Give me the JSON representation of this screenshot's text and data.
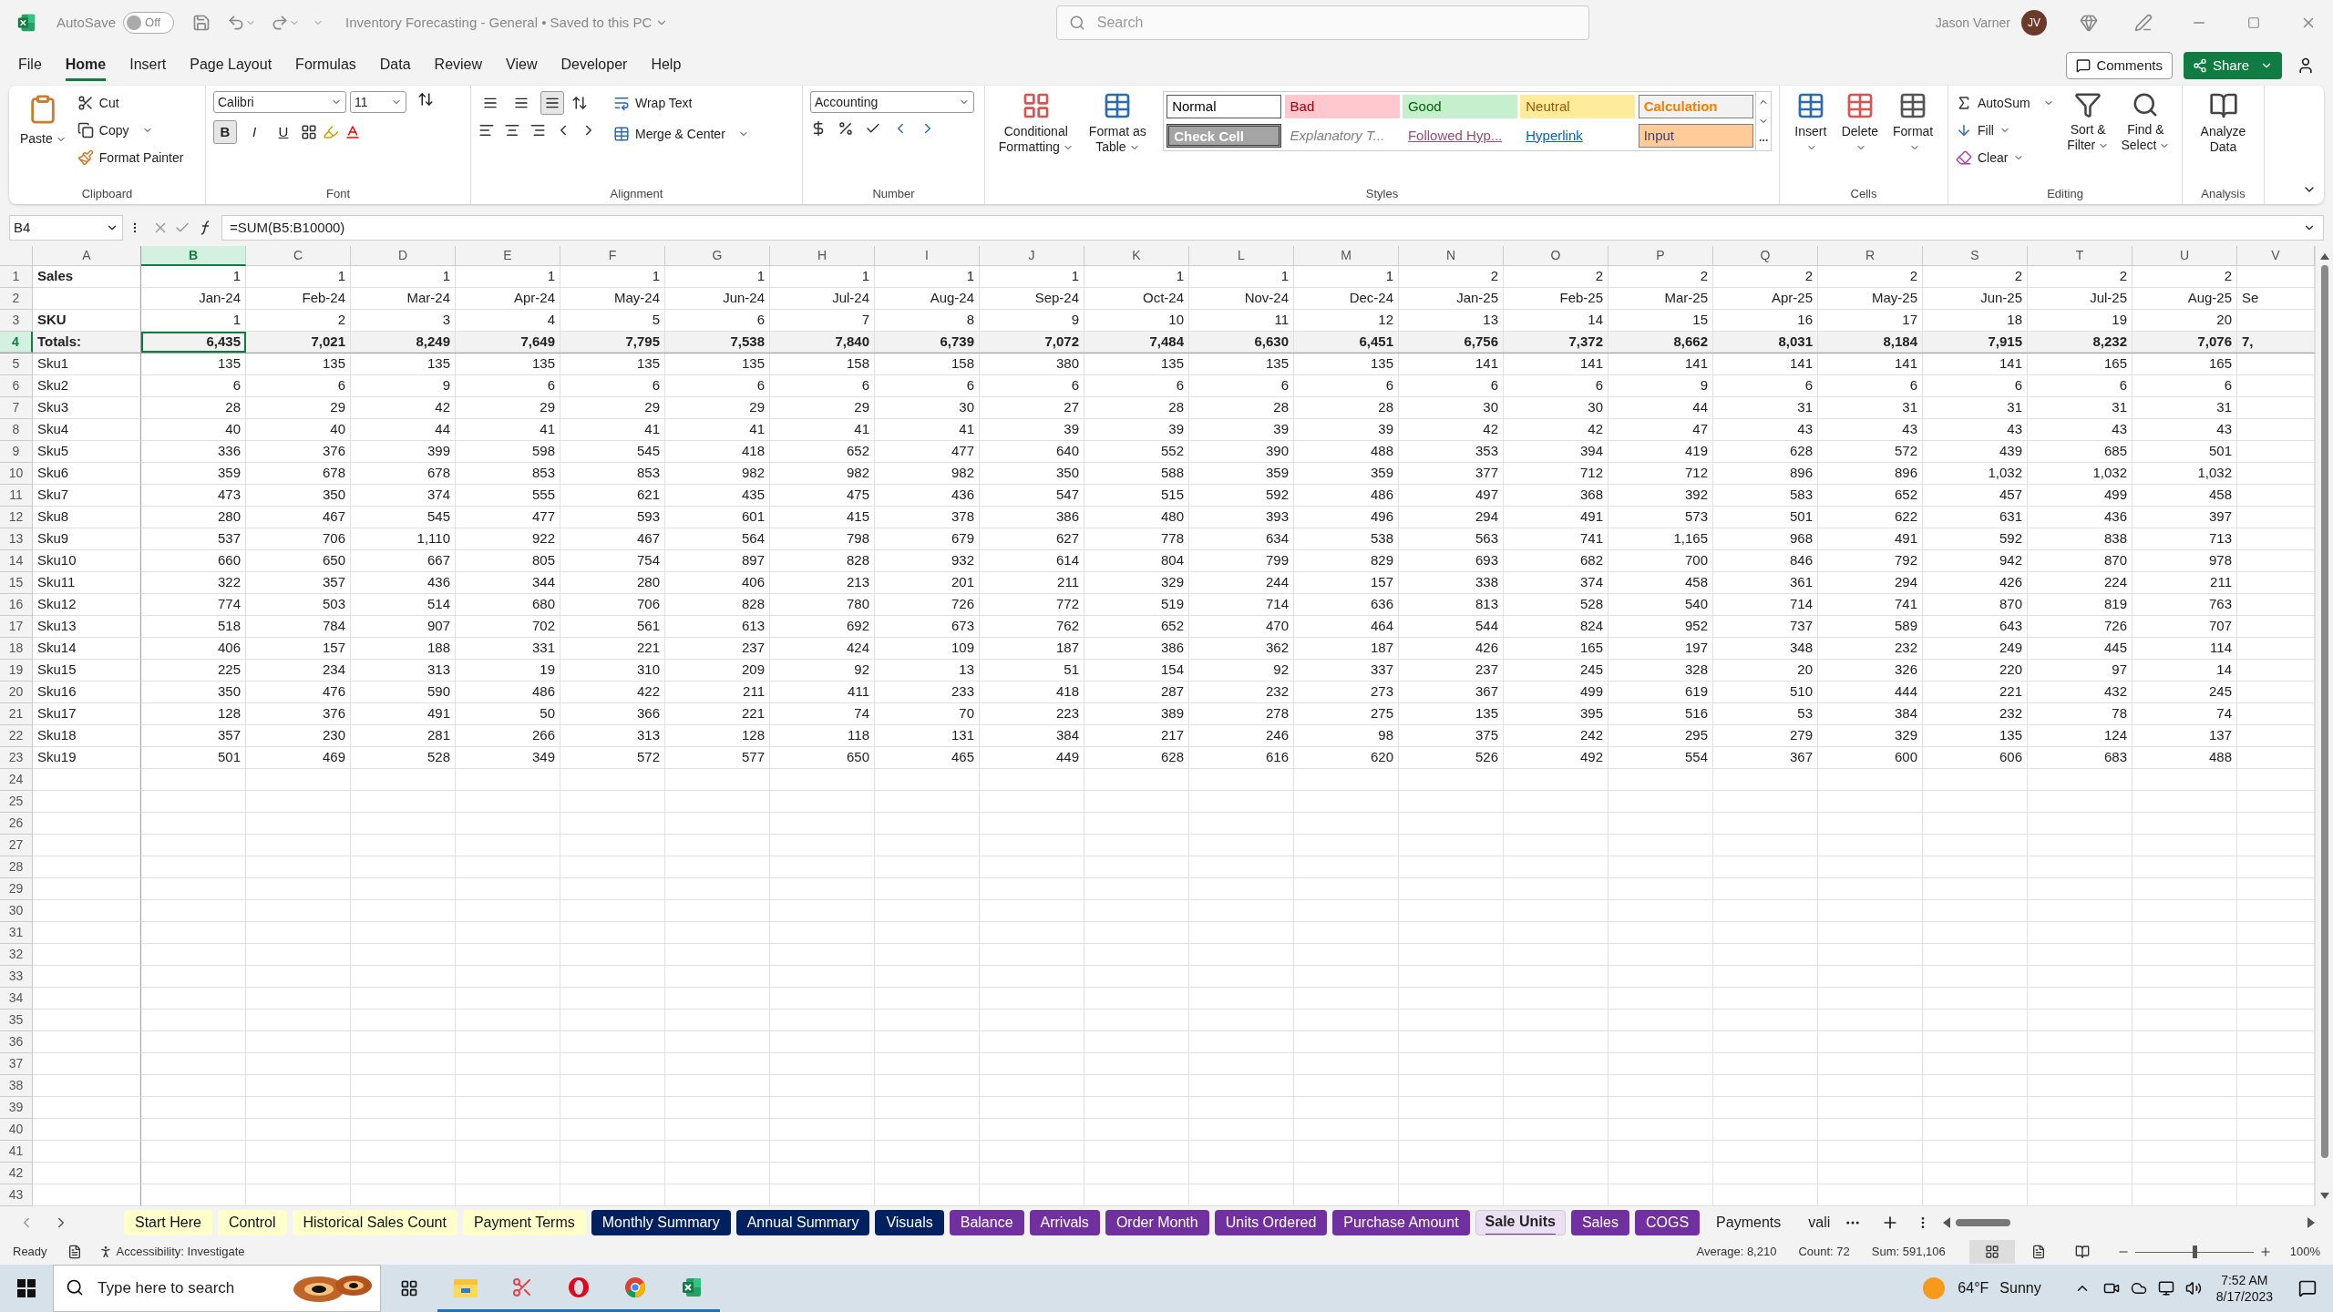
{
  "title_bar": {
    "autosave_label": "AutoSave",
    "autosave_on": false,
    "autosave_state": "Off",
    "document_title": "Inventory Forecasting - General • Saved to this PC",
    "search_placeholder": "Search",
    "user_name": "Jason Varner",
    "user_initials": "JV"
  },
  "menu_tabs": [
    {
      "label": "File",
      "selected": false
    },
    {
      "label": "Home",
      "selected": true
    },
    {
      "label": "Insert",
      "selected": false
    },
    {
      "label": "Page Layout",
      "selected": false
    },
    {
      "label": "Formulas",
      "selected": false
    },
    {
      "label": "Data",
      "selected": false
    },
    {
      "label": "Review",
      "selected": false
    },
    {
      "label": "View",
      "selected": false
    },
    {
      "label": "Developer",
      "selected": false
    },
    {
      "label": "Help",
      "selected": false
    }
  ],
  "header_buttons": {
    "comments": "Comments",
    "share": "Share"
  },
  "ribbon": {
    "clipboard": {
      "label": "Clipboard",
      "paste": "Paste",
      "cut": "Cut",
      "copy": "Copy",
      "format_painter": "Format Painter"
    },
    "font": {
      "label": "Font",
      "name": "Calibri",
      "size": "11",
      "styles": [
        {
          "label": "B",
          "selected": true
        },
        {
          "label": "I",
          "selected": false
        },
        {
          "label": "U",
          "selected": false
        }
      ]
    },
    "alignment": {
      "label": "Alignment",
      "vertical": [
        {
          "selected": false
        },
        {
          "selected": false
        },
        {
          "selected": true
        }
      ],
      "wrap_text": "Wrap Text",
      "merge_center": "Merge & Center"
    },
    "number": {
      "label": "Number",
      "format": "Accounting"
    },
    "styles": {
      "label": "Styles",
      "conditional_formatting": "Conditional Formatting",
      "format_as_table": "Format as Table",
      "items": [
        {
          "label": "Normal",
          "kind": "normal"
        },
        {
          "label": "Bad",
          "kind": "bad"
        },
        {
          "label": "Good",
          "kind": "good"
        },
        {
          "label": "Neutral",
          "kind": "neutral"
        },
        {
          "label": "Calculation",
          "kind": "calculation"
        },
        {
          "label": "Check Cell",
          "kind": "check"
        },
        {
          "label": "Explanatory T...",
          "kind": "explanatory"
        },
        {
          "label": "Followed Hyp...",
          "kind": "followed"
        },
        {
          "label": "Hyperlink",
          "kind": "hyperlink"
        },
        {
          "label": "Input",
          "kind": "input"
        }
      ]
    },
    "cells": {
      "label": "Cells",
      "insert": "Insert",
      "delete": "Delete",
      "format": "Format"
    },
    "editing": {
      "label": "Editing",
      "autosum": "AutoSum",
      "fill": "Fill",
      "clear": "Clear",
      "sort_filter": "Sort & Filter",
      "find_select": "Find & Select"
    },
    "analysis": {
      "label": "Analysis",
      "analyze_data": "Analyze Data"
    }
  },
  "formula_bar": {
    "name_box": "B4",
    "formula": "=SUM(B5:B10000)"
  },
  "columns": [
    {
      "letter": "A",
      "selected": false
    },
    {
      "letter": "B",
      "selected": true
    },
    {
      "letter": "C",
      "selected": false
    },
    {
      "letter": "D",
      "selected": false
    },
    {
      "letter": "E",
      "selected": false
    },
    {
      "letter": "F",
      "selected": false
    },
    {
      "letter": "G",
      "selected": false
    },
    {
      "letter": "H",
      "selected": false
    },
    {
      "letter": "I",
      "selected": false
    },
    {
      "letter": "J",
      "selected": false
    },
    {
      "letter": "K",
      "selected": false
    },
    {
      "letter": "L",
      "selected": false
    },
    {
      "letter": "M",
      "selected": false
    },
    {
      "letter": "N",
      "selected": false
    },
    {
      "letter": "O",
      "selected": false
    },
    {
      "letter": "P",
      "selected": false
    },
    {
      "letter": "Q",
      "selected": false
    },
    {
      "letter": "R",
      "selected": false
    },
    {
      "letter": "S",
      "selected": false
    },
    {
      "letter": "T",
      "selected": false
    },
    {
      "letter": "U",
      "selected": false
    },
    {
      "letter": "V",
      "selected": false
    }
  ],
  "rows": [
    {
      "number": "1",
      "kind": "header",
      "selected": false,
      "label": "Sales",
      "values": [
        "1",
        "1",
        "1",
        "1",
        "1",
        "1",
        "1",
        "1",
        "1",
        "1",
        "1",
        "1",
        "2",
        "2",
        "2",
        "2",
        "2",
        "2",
        "2",
        "2"
      ]
    },
    {
      "number": "2",
      "kind": "header",
      "selected": false,
      "values": [
        "Jan-24",
        "Feb-24",
        "Mar-24",
        "Apr-24",
        "May-24",
        "Jun-24",
        "Jul-24",
        "Aug-24",
        "Sep-24",
        "Oct-24",
        "Nov-24",
        "Dec-24",
        "Jan-25",
        "Feb-25",
        "Mar-25",
        "Apr-25",
        "May-25",
        "Jun-25",
        "Jul-25",
        "Aug-25",
        "Se"
      ]
    },
    {
      "number": "3",
      "kind": "header",
      "selected": false,
      "label": "SKU",
      "values": [
        "1",
        "2",
        "3",
        "4",
        "5",
        "6",
        "7",
        "8",
        "9",
        "10",
        "11",
        "12",
        "13",
        "14",
        "15",
        "16",
        "17",
        "18",
        "19",
        "20"
      ]
    },
    {
      "number": "4",
      "kind": "totals",
      "selected": true,
      "label": "Totals:",
      "values": [
        "6,435",
        "7,021",
        "8,249",
        "7,649",
        "7,795",
        "7,538",
        "7,840",
        "6,739",
        "7,072",
        "7,484",
        "6,630",
        "6,451",
        "6,756",
        "7,372",
        "8,662",
        "8,031",
        "8,184",
        "7,915",
        "8,232",
        "7,076",
        "7,"
      ]
    },
    {
      "number": "5",
      "kind": "data",
      "selected": false,
      "label": "Sku1",
      "values": [
        "135",
        "135",
        "135",
        "135",
        "135",
        "135",
        "158",
        "158",
        "380",
        "135",
        "135",
        "135",
        "141",
        "141",
        "141",
        "141",
        "141",
        "141",
        "165",
        "165"
      ]
    },
    {
      "number": "6",
      "kind": "data",
      "selected": false,
      "label": "Sku2",
      "values": [
        "6",
        "6",
        "9",
        "6",
        "6",
        "6",
        "6",
        "6",
        "6",
        "6",
        "6",
        "6",
        "6",
        "6",
        "9",
        "6",
        "6",
        "6",
        "6",
        "6"
      ]
    },
    {
      "number": "7",
      "kind": "data",
      "selected": false,
      "label": "Sku3",
      "values": [
        "28",
        "29",
        "42",
        "29",
        "29",
        "29",
        "29",
        "30",
        "27",
        "28",
        "28",
        "28",
        "30",
        "30",
        "44",
        "31",
        "31",
        "31",
        "31",
        "31"
      ]
    },
    {
      "number": "8",
      "kind": "data",
      "selected": false,
      "label": "Sku4",
      "values": [
        "40",
        "40",
        "44",
        "41",
        "41",
        "41",
        "41",
        "41",
        "39",
        "39",
        "39",
        "39",
        "42",
        "42",
        "47",
        "43",
        "43",
        "43",
        "43",
        "43"
      ]
    },
    {
      "number": "9",
      "kind": "data",
      "selected": false,
      "label": "Sku5",
      "values": [
        "336",
        "376",
        "399",
        "598",
        "545",
        "418",
        "652",
        "477",
        "640",
        "552",
        "390",
        "488",
        "353",
        "394",
        "419",
        "628",
        "572",
        "439",
        "685",
        "501"
      ]
    },
    {
      "number": "10",
      "kind": "data",
      "selected": false,
      "label": "Sku6",
      "values": [
        "359",
        "678",
        "678",
        "853",
        "853",
        "982",
        "982",
        "982",
        "350",
        "588",
        "359",
        "359",
        "377",
        "712",
        "712",
        "896",
        "896",
        "1,032",
        "1,032",
        "1,032"
      ]
    },
    {
      "number": "11",
      "kind": "data",
      "selected": false,
      "label": "Sku7",
      "values": [
        "473",
        "350",
        "374",
        "555",
        "621",
        "435",
        "475",
        "436",
        "547",
        "515",
        "592",
        "486",
        "497",
        "368",
        "392",
        "583",
        "652",
        "457",
        "499",
        "458"
      ]
    },
    {
      "number": "12",
      "kind": "data",
      "selected": false,
      "label": "Sku8",
      "values": [
        "280",
        "467",
        "545",
        "477",
        "593",
        "601",
        "415",
        "378",
        "386",
        "480",
        "393",
        "496",
        "294",
        "491",
        "573",
        "501",
        "622",
        "631",
        "436",
        "397"
      ]
    },
    {
      "number": "13",
      "kind": "data",
      "selected": false,
      "label": "Sku9",
      "values": [
        "537",
        "706",
        "1,110",
        "922",
        "467",
        "564",
        "798",
        "679",
        "627",
        "778",
        "634",
        "538",
        "563",
        "741",
        "1,165",
        "968",
        "491",
        "592",
        "838",
        "713"
      ]
    },
    {
      "number": "14",
      "kind": "data",
      "selected": false,
      "label": "Sku10",
      "values": [
        "660",
        "650",
        "667",
        "805",
        "754",
        "897",
        "828",
        "932",
        "614",
        "804",
        "799",
        "829",
        "693",
        "682",
        "700",
        "846",
        "792",
        "942",
        "870",
        "978"
      ]
    },
    {
      "number": "15",
      "kind": "data",
      "selected": false,
      "label": "Sku11",
      "values": [
        "322",
        "357",
        "436",
        "344",
        "280",
        "406",
        "213",
        "201",
        "211",
        "329",
        "244",
        "157",
        "338",
        "374",
        "458",
        "361",
        "294",
        "426",
        "224",
        "211"
      ]
    },
    {
      "number": "16",
      "kind": "data",
      "selected": false,
      "label": "Sku12",
      "values": [
        "774",
        "503",
        "514",
        "680",
        "706",
        "828",
        "780",
        "726",
        "772",
        "519",
        "714",
        "636",
        "813",
        "528",
        "540",
        "714",
        "741",
        "870",
        "819",
        "763"
      ]
    },
    {
      "number": "17",
      "kind": "data",
      "selected": false,
      "label": "Sku13",
      "values": [
        "518",
        "784",
        "907",
        "702",
        "561",
        "613",
        "692",
        "673",
        "762",
        "652",
        "470",
        "464",
        "544",
        "824",
        "952",
        "737",
        "589",
        "643",
        "726",
        "707"
      ]
    },
    {
      "number": "18",
      "kind": "data",
      "selected": false,
      "label": "Sku14",
      "values": [
        "406",
        "157",
        "188",
        "331",
        "221",
        "237",
        "424",
        "109",
        "187",
        "386",
        "362",
        "187",
        "426",
        "165",
        "197",
        "348",
        "232",
        "249",
        "445",
        "114"
      ]
    },
    {
      "number": "19",
      "kind": "data",
      "selected": false,
      "label": "Sku15",
      "values": [
        "225",
        "234",
        "313",
        "19",
        "310",
        "209",
        "92",
        "13",
        "51",
        "154",
        "92",
        "337",
        "237",
        "245",
        "328",
        "20",
        "326",
        "220",
        "97",
        "14"
      ]
    },
    {
      "number": "20",
      "kind": "data",
      "selected": false,
      "label": "Sku16",
      "values": [
        "350",
        "476",
        "590",
        "486",
        "422",
        "211",
        "411",
        "233",
        "418",
        "287",
        "232",
        "273",
        "367",
        "499",
        "619",
        "510",
        "444",
        "221",
        "432",
        "245"
      ]
    },
    {
      "number": "21",
      "kind": "data",
      "selected": false,
      "label": "Sku17",
      "values": [
        "128",
        "376",
        "491",
        "50",
        "366",
        "221",
        "74",
        "70",
        "223",
        "389",
        "278",
        "275",
        "135",
        "395",
        "516",
        "53",
        "384",
        "232",
        "78",
        "74"
      ]
    },
    {
      "number": "22",
      "kind": "data",
      "selected": false,
      "label": "Sku18",
      "values": [
        "357",
        "230",
        "281",
        "266",
        "313",
        "128",
        "118",
        "131",
        "384",
        "217",
        "246",
        "98",
        "375",
        "242",
        "295",
        "279",
        "329",
        "135",
        "124",
        "137"
      ]
    },
    {
      "number": "23",
      "kind": "data",
      "selected": false,
      "label": "Sku19",
      "values": [
        "501",
        "469",
        "528",
        "349",
        "572",
        "577",
        "650",
        "465",
        "449",
        "628",
        "616",
        "620",
        "526",
        "492",
        "554",
        "367",
        "600",
        "606",
        "683",
        "488"
      ]
    },
    {
      "number": "24",
      "kind": "blank",
      "selected": false
    },
    {
      "number": "25",
      "kind": "blank",
      "selected": false
    },
    {
      "number": "26",
      "kind": "blank",
      "selected": false
    },
    {
      "number": "27",
      "kind": "blank",
      "selected": false
    },
    {
      "number": "28",
      "kind": "blank",
      "selected": false
    },
    {
      "number": "29",
      "kind": "blank",
      "selected": false
    },
    {
      "number": "30",
      "kind": "blank",
      "selected": false
    },
    {
      "number": "31",
      "kind": "blank",
      "selected": false
    },
    {
      "number": "32",
      "kind": "blank",
      "selected": false
    },
    {
      "number": "33",
      "kind": "blank",
      "selected": false
    },
    {
      "number": "34",
      "kind": "blank",
      "selected": false
    },
    {
      "number": "35",
      "kind": "blank",
      "selected": false
    },
    {
      "number": "36",
      "kind": "blank",
      "selected": false
    },
    {
      "number": "37",
      "kind": "blank",
      "selected": false
    },
    {
      "number": "38",
      "kind": "blank",
      "selected": false
    },
    {
      "number": "39",
      "kind": "blank",
      "selected": false
    },
    {
      "number": "40",
      "kind": "blank",
      "selected": false
    },
    {
      "number": "41",
      "kind": "blank",
      "selected": false
    },
    {
      "number": "42",
      "kind": "blank",
      "selected": false
    },
    {
      "number": "43",
      "kind": "blank",
      "selected": false
    }
  ],
  "sheet_tabs": [
    {
      "label": "Start Here",
      "color": "#ffffcc",
      "selected": false
    },
    {
      "label": "Control",
      "color": "#ffffcc",
      "selected": false
    },
    {
      "label": "Historical Sales Count",
      "color": "#ffffcc",
      "selected": false
    },
    {
      "label": "Payment Terms",
      "color": "#ffffcc",
      "selected": false
    },
    {
      "label": "Monthly Summary",
      "color": "#002060",
      "selected": false
    },
    {
      "label": "Annual Summary",
      "color": "#002060",
      "selected": false
    },
    {
      "label": "Visuals",
      "color": "#002060",
      "selected": false
    },
    {
      "label": "Balance",
      "color": "#7030a0",
      "selected": false
    },
    {
      "label": "Arrivals",
      "color": "#7030a0",
      "selected": false
    },
    {
      "label": "Order Month",
      "color": "#7030a0",
      "selected": false
    },
    {
      "label": "Units Ordered",
      "color": "#7030a0",
      "selected": false
    },
    {
      "label": "Purchase Amount",
      "color": "#7030a0",
      "selected": false
    },
    {
      "label": "Sale Units",
      "color": "#7030a0",
      "selected": true
    },
    {
      "label": "Sales",
      "color": "#7030a0",
      "selected": false
    },
    {
      "label": "COGS",
      "color": "#7030a0",
      "selected": false
    },
    {
      "label": "Payments",
      "selected": false
    },
    {
      "label": "vali",
      "selected": false
    }
  ],
  "status_bar": {
    "mode": "Ready",
    "accessibility": "Accessibility: Investigate",
    "average": "Average: 8,210",
    "count": "Count: 72",
    "sum": "Sum: 591,106",
    "zoom": {
      "level": 0.5,
      "reading": "100%"
    }
  },
  "taskbar": {
    "search_placeholder": "Type here to search",
    "temperature": "64°F",
    "weather": "Sunny",
    "time": "7:52 AM",
    "date": "8/17/2023"
  }
}
